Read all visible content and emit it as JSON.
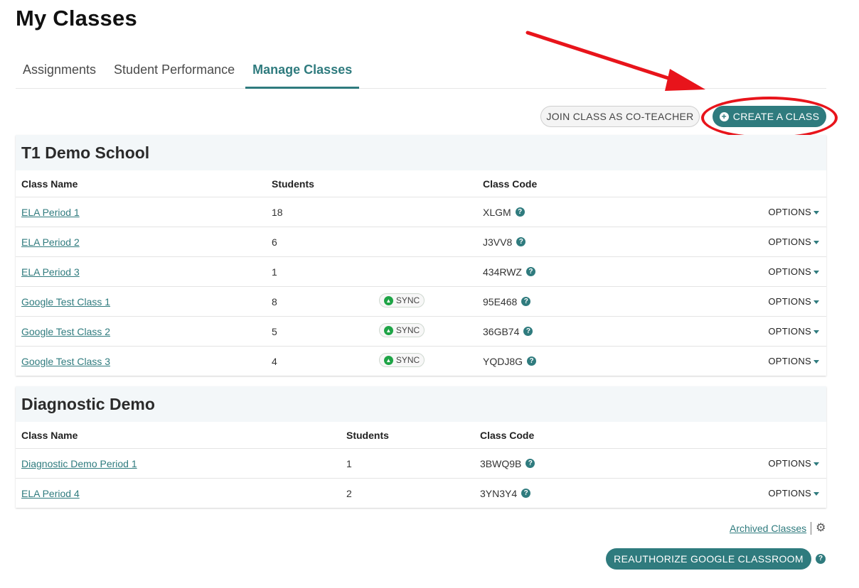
{
  "page_title": "My Classes",
  "tabs": [
    {
      "label": "Assignments",
      "active": false
    },
    {
      "label": "Student Performance",
      "active": false
    },
    {
      "label": "Manage Classes",
      "active": true
    }
  ],
  "actions": {
    "join_label": "JOIN CLASS AS CO-TEACHER",
    "create_label": "CREATE A CLASS"
  },
  "schools": [
    {
      "name": "T1 Demo School",
      "columns": [
        "Class Name",
        "Students",
        "Class Code"
      ],
      "rows": [
        {
          "name": "ELA Period 1",
          "students": "18",
          "sync": false,
          "code": "XLGM"
        },
        {
          "name": "ELA Period 2",
          "students": "6",
          "sync": false,
          "code": "J3VV8"
        },
        {
          "name": "ELA Period 3",
          "students": "1",
          "sync": false,
          "code": "434RWZ"
        },
        {
          "name": "Google Test Class 1",
          "students": "8",
          "sync": true,
          "code": "95E468"
        },
        {
          "name": "Google Test Class 2",
          "students": "5",
          "sync": true,
          "code": "36GB74"
        },
        {
          "name": "Google Test Class 3",
          "students": "4",
          "sync": true,
          "code": "YQDJ8G"
        }
      ]
    },
    {
      "name": "Diagnostic Demo",
      "columns": [
        "Class Name",
        "Students",
        "Class Code"
      ],
      "rows": [
        {
          "name": "Diagnostic Demo Period 1",
          "students": "1",
          "sync": false,
          "code": "3BWQ9B"
        },
        {
          "name": "ELA Period 4",
          "students": "2",
          "sync": false,
          "code": "3YN3Y4"
        }
      ]
    }
  ],
  "row_labels": {
    "options": "OPTIONS",
    "sync": "SYNC"
  },
  "footer": {
    "archived_label": "Archived Classes",
    "reauth_label": "REAUTHORIZE GOOGLE CLASSROOM"
  },
  "icons": {
    "help": "question-circle-icon",
    "settings": "gear-icon",
    "add": "plus-circle-icon",
    "dropdown": "caret-down-icon",
    "google": "google-classroom-icon"
  },
  "colors": {
    "accent": "#2f7b7e",
    "annotation": "#e8141b",
    "sync_green": "#1ea446",
    "section_header_bg": "#f3f7f9"
  }
}
